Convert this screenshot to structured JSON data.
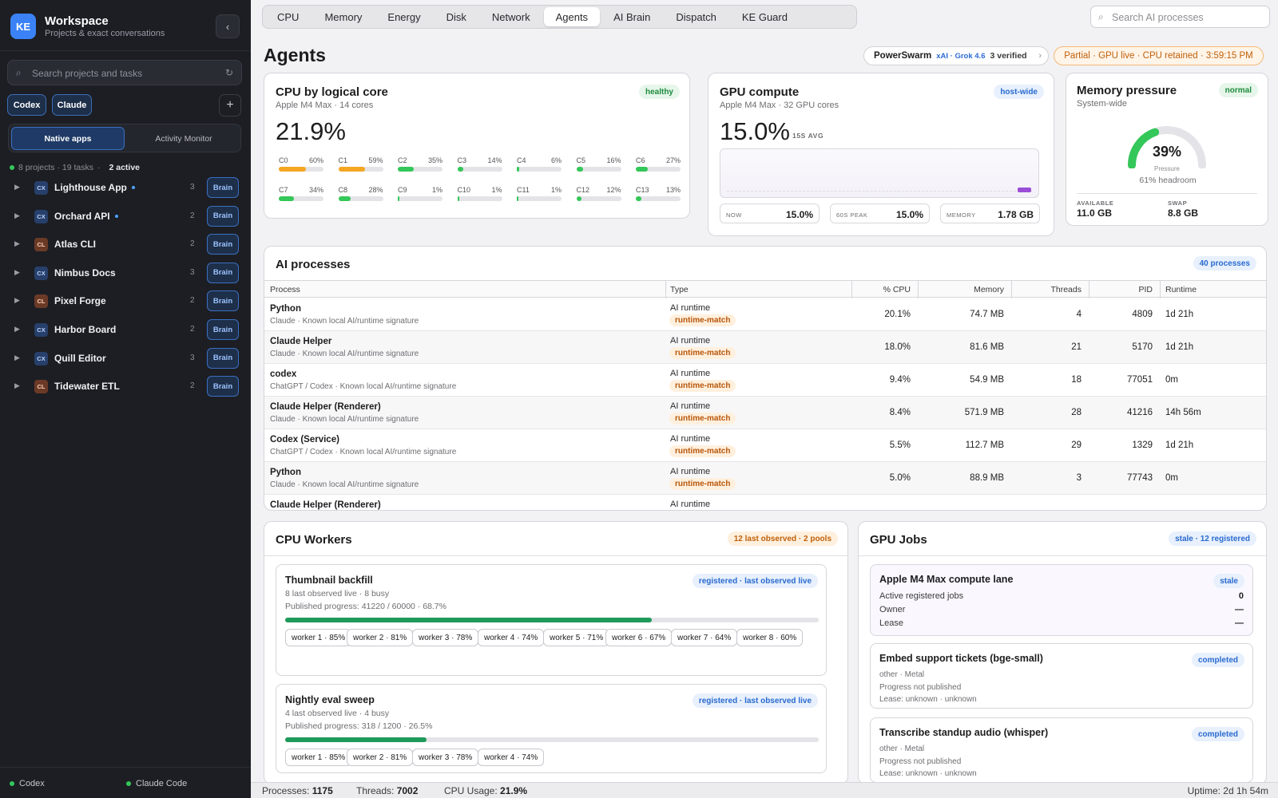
{
  "sidebar": {
    "logo": "KE",
    "title": "Workspace",
    "subtitle": "Projects & exact conversations",
    "collapse": "‹",
    "search_placeholder": "Search projects and tasks",
    "filters": [
      "Codex",
      "Claude"
    ],
    "add": "+",
    "segments": [
      "Native apps",
      "Activity Monitor"
    ],
    "stats": "8 projects · 19 tasks",
    "active": "2 active",
    "projects": [
      {
        "tag": "CX",
        "name": "Lighthouse App",
        "count": "3",
        "live": true,
        "brain": "Brain"
      },
      {
        "tag": "CX",
        "name": "Orchard API",
        "count": "2",
        "live": true,
        "brain": "Brain"
      },
      {
        "tag": "CL",
        "name": "Atlas CLI",
        "count": "2",
        "live": false,
        "brain": "Brain"
      },
      {
        "tag": "CX",
        "name": "Nimbus Docs",
        "count": "3",
        "live": false,
        "brain": "Brain"
      },
      {
        "tag": "CL",
        "name": "Pixel Forge",
        "count": "2",
        "live": false,
        "brain": "Brain"
      },
      {
        "tag": "CX",
        "name": "Harbor Board",
        "count": "2",
        "live": false,
        "brain": "Brain"
      },
      {
        "tag": "CX",
        "name": "Quill Editor",
        "count": "3",
        "live": false,
        "brain": "Brain"
      },
      {
        "tag": "CL",
        "name": "Tidewater ETL",
        "count": "2",
        "live": false,
        "brain": "Brain"
      }
    ],
    "footer": [
      "Codex",
      "Claude Code"
    ]
  },
  "tabs": [
    "CPU",
    "Memory",
    "Energy",
    "Disk",
    "Network",
    "Agents",
    "AI Brain",
    "Dispatch",
    "KE Guard"
  ],
  "active_tab": "Agents",
  "search_placeholder": "Search AI processes",
  "page_title": "Agents",
  "swarm": {
    "name": "PowerSwarm",
    "model": "xAI · Grok 4.6",
    "verified": "3 verified",
    "chev": "›"
  },
  "partial_status": "Partial · GPU live · CPU retained · 3:59:15 PM",
  "cpu": {
    "title": "CPU by logical core",
    "subtitle": "Apple M4 Max · 14 cores",
    "badge": "healthy",
    "total": "21.9%",
    "cores": [
      {
        "label": "C0",
        "value": "60%",
        "pct": 60
      },
      {
        "label": "C1",
        "value": "59%",
        "pct": 59
      },
      {
        "label": "C2",
        "value": "35%",
        "pct": 35
      },
      {
        "label": "C3",
        "value": "14%",
        "pct": 14
      },
      {
        "label": "C4",
        "value": "6%",
        "pct": 6
      },
      {
        "label": "C5",
        "value": "16%",
        "pct": 16
      },
      {
        "label": "C6",
        "value": "27%",
        "pct": 27
      },
      {
        "label": "C7",
        "value": "34%",
        "pct": 34
      },
      {
        "label": "C8",
        "value": "28%",
        "pct": 28
      },
      {
        "label": "C9",
        "value": "1%",
        "pct": 1
      },
      {
        "label": "C10",
        "value": "1%",
        "pct": 1
      },
      {
        "label": "C11",
        "value": "1%",
        "pct": 1
      },
      {
        "label": "C12",
        "value": "12%",
        "pct": 12
      },
      {
        "label": "C13",
        "value": "13%",
        "pct": 13
      }
    ],
    "colors": {
      "high": "#f5a623",
      "low": "#34c759"
    }
  },
  "gpu": {
    "title": "GPU compute",
    "subtitle": "Apple M4 Max · 32 GPU cores",
    "badge": "host-wide",
    "value": "15.0%",
    "avg_label": "15S AVG",
    "stats": [
      {
        "label": "NOW",
        "value": "15.0%"
      },
      {
        "label": "60S PEAK",
        "value": "15.0%"
      },
      {
        "label": "MEMORY",
        "value": "1.78 GB"
      }
    ]
  },
  "memory": {
    "title": "Memory pressure",
    "subtitle": "System-wide",
    "badge": "normal",
    "pressure": "39%",
    "pressure_pct": 39,
    "pressure_label": "Pressure",
    "headroom": "61% headroom",
    "available_label": "AVAILABLE",
    "available": "11.0 GB",
    "swap_label": "SWAP",
    "swap": "8.8 GB"
  },
  "processes": {
    "title": "AI processes",
    "badge": "40 processes",
    "columns": [
      "Process",
      "Type",
      "% CPU",
      "Memory",
      "Threads",
      "PID",
      "Runtime"
    ],
    "rows": [
      {
        "name": "Python",
        "desc": "Claude · Known local AI/runtime signature",
        "type": "AI runtime",
        "match": "runtime-match",
        "cpu": "20.1%",
        "mem": "74.7 MB",
        "threads": "4",
        "pid": "4809",
        "runtime": "1d 21h"
      },
      {
        "name": "Claude Helper",
        "desc": "Claude · Known local AI/runtime signature",
        "type": "AI runtime",
        "match": "runtime-match",
        "cpu": "18.0%",
        "mem": "81.6 MB",
        "threads": "21",
        "pid": "5170",
        "runtime": "1d 21h"
      },
      {
        "name": "codex",
        "desc": "ChatGPT / Codex · Known local AI/runtime signature",
        "type": "AI runtime",
        "match": "runtime-match",
        "cpu": "9.4%",
        "mem": "54.9 MB",
        "threads": "18",
        "pid": "77051",
        "runtime": "0m"
      },
      {
        "name": "Claude Helper (Renderer)",
        "desc": "Claude · Known local AI/runtime signature",
        "type": "AI runtime",
        "match": "runtime-match",
        "cpu": "8.4%",
        "mem": "571.9 MB",
        "threads": "28",
        "pid": "41216",
        "runtime": "14h 56m"
      },
      {
        "name": "Codex (Service)",
        "desc": "ChatGPT / Codex · Known local AI/runtime signature",
        "type": "AI runtime",
        "match": "runtime-match",
        "cpu": "5.5%",
        "mem": "112.7 MB",
        "threads": "29",
        "pid": "1329",
        "runtime": "1d 21h"
      },
      {
        "name": "Python",
        "desc": "Claude · Known local AI/runtime signature",
        "type": "AI runtime",
        "match": "runtime-match",
        "cpu": "5.0%",
        "mem": "88.9 MB",
        "threads": "3",
        "pid": "77743",
        "runtime": "0m"
      },
      {
        "name": "Claude Helper (Renderer)",
        "desc": "",
        "type": "AI runtime",
        "match": "",
        "cpu": "",
        "mem": "",
        "threads": "",
        "pid": "",
        "runtime": ""
      }
    ]
  },
  "cpu_workers": {
    "title": "CPU Workers",
    "badge": "12 last observed · 2 pools",
    "pools": [
      {
        "name": "Thumbnail backfill",
        "badge": "registered · last observed live",
        "live": "8 last observed live · 8 busy",
        "progress": "Published progress: 41220 / 60000 · 68.7%",
        "pct": 68.7,
        "workers": [
          "worker 1 · 85%",
          "worker 2 · 81%",
          "worker 3 · 78%",
          "worker 4 · 74%",
          "worker 5 · 71%",
          "worker 6 · 67%",
          "worker 7 · 64%",
          "worker 8 · 60%"
        ]
      },
      {
        "name": "Nightly eval sweep",
        "badge": "registered · last observed live",
        "live": "4 last observed live · 4 busy",
        "progress": "Published progress: 318 / 1200 · 26.5%",
        "pct": 26.5,
        "workers": [
          "worker 1 · 85%",
          "worker 2 · 81%",
          "worker 3 · 78%",
          "worker 4 · 74%"
        ]
      }
    ]
  },
  "gpu_jobs": {
    "title": "GPU Jobs",
    "badge": "stale · 12 registered",
    "lane": {
      "name": "Apple M4 Max compute lane",
      "badge": "stale",
      "rows": [
        {
          "label": "Active registered jobs",
          "value": "0"
        },
        {
          "label": "Owner",
          "value": "—"
        },
        {
          "label": "Lease",
          "value": "—"
        }
      ]
    },
    "jobs": [
      {
        "name": "Embed support tickets (bge-small)",
        "badge": "completed",
        "lines": [
          "other · Metal",
          "Progress not published",
          "Lease: unknown · unknown"
        ]
      },
      {
        "name": "Transcribe standup audio (whisper)",
        "badge": "completed",
        "lines": [
          "other · Metal",
          "Progress not published",
          "Lease: unknown · unknown"
        ]
      }
    ]
  },
  "status": {
    "processes_label": "Processes:",
    "processes": "1175",
    "threads_label": "Threads:",
    "threads": "7002",
    "cpu_label": "CPU Usage:",
    "cpu": "21.9%",
    "uptime": "Uptime: 2d 1h 54m"
  }
}
